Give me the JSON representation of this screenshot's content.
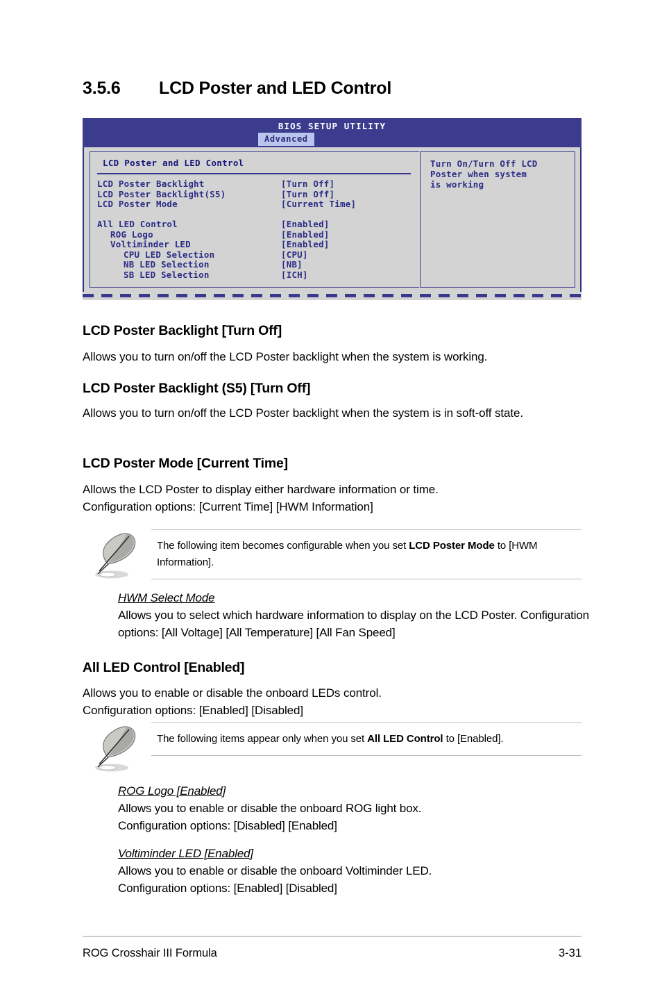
{
  "section": {
    "number": "3.5.6",
    "title": "LCD Poster and LED Control"
  },
  "bios": {
    "title": "BIOS SETUP UTILITY",
    "tab": "Advanced",
    "panel_title": "LCD Poster and LED Control",
    "items": [
      {
        "label": "LCD Poster Backlight",
        "value": "[Turn Off]",
        "indent": 0
      },
      {
        "label": "LCD Poster Backlight(S5)",
        "value": "[Turn Off]",
        "indent": 0
      },
      {
        "label": "LCD Poster Mode",
        "value": "[Current Time]",
        "indent": 0
      },
      {
        "label": "",
        "value": "",
        "indent": 0
      },
      {
        "label": "All LED Control",
        "value": "[Enabled]",
        "indent": 0
      },
      {
        "label": "ROG Logo",
        "value": "[Enabled]",
        "indent": 1
      },
      {
        "label": "Voltiminder LED",
        "value": "[Enabled]",
        "indent": 1
      },
      {
        "label": "CPU LED Selection",
        "value": "[CPU]",
        "indent": 2
      },
      {
        "label": "NB LED Selection",
        "value": "[NB]",
        "indent": 2
      },
      {
        "label": "SB LED Selection",
        "value": "[ICH]",
        "indent": 2
      }
    ],
    "help_text": "Turn On/Turn Off LCD\nPoster when system\nis working",
    "colors": {
      "header_bg": "#3b3c8e",
      "body_bg": "#d3d3d3",
      "text": "#2c2c86",
      "tab_bg": "#b9c5ec"
    }
  },
  "body": {
    "h1_title": "LCD Poster Backlight [Turn Off]",
    "h1_text": "Allows you to turn on/off the LCD Poster backlight when the system is working.",
    "h2_title": "LCD Poster Backlight (S5) [Turn Off]",
    "h2_text": "Allows you to turn on/off the LCD Poster backlight when the system is in soft-off state.",
    "h3_title": "LCD Poster Mode [Current Time]",
    "h3_text_line1": "Allows the LCD Poster to display either hardware information or time.",
    "h3_text_line2": "Configuration options: [Current Time] [HWM Information]",
    "note1_pre": "The following item becomes configurable when you set ",
    "note1_bold": "LCD Poster Mode",
    "note1_post": " to [HWM Information].",
    "sub1_title": "HWM Select Mode",
    "sub1_text": "Allows you to select which hardware information to display on the LCD Poster. Configuration options: [All Voltage] [All Temperature] [All Fan Speed]",
    "h4_title": "All LED Control [Enabled]",
    "h4_text_line1": "Allows you to enable or disable the onboard LEDs control.",
    "h4_text_line2": "Configuration options: [Enabled] [Disabled]",
    "note2_pre": "The following items appear only when you set ",
    "note2_bold": "All LED Control",
    "note2_post": " to [Enabled].",
    "sub2_title": "ROG Logo [Enabled]",
    "sub2_text_line1": "Allows you to enable or disable the onboard ROG light box.",
    "sub2_text_line2": "Configuration options: [Disabled] [Enabled]",
    "sub3_title": "Voltiminder LED [Enabled]",
    "sub3_text_line1": "Allows you to enable or disable the onboard Voltiminder LED.",
    "sub3_text_line2": "Configuration options: [Enabled] [Disabled]"
  },
  "footer": {
    "left": "ROG Crosshair III Formula",
    "right": "3-31"
  }
}
